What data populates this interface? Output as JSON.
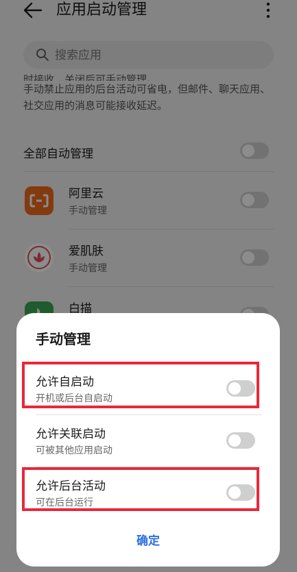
{
  "header": {
    "title": "应用启动管理",
    "back_icon": "arrow-left-icon",
    "more_icon": "more-vertical-icon"
  },
  "search": {
    "placeholder": "搜索应用",
    "icon": "search-icon"
  },
  "description": {
    "line_clipped": "时接收，关闭后可手动管理。",
    "text": "手动禁止应用的后台活动可省电，但邮件、聊天应用、社交应用的消息可能接收延迟。"
  },
  "all_auto": {
    "label": "全部自动管理",
    "enabled": false
  },
  "apps": [
    {
      "name": "阿里云",
      "status": "手动管理",
      "icon": "aliyun-icon",
      "enabled": false
    },
    {
      "name": "爱肌肤",
      "status": "手动管理",
      "icon": "aijifu-icon",
      "enabled": false
    },
    {
      "name": "白描",
      "status": "",
      "icon": "baimiao-icon",
      "enabled": false
    }
  ],
  "dialog": {
    "title": "手动管理",
    "options": [
      {
        "label": "允许自启动",
        "sub": "开机或后台自启动",
        "enabled": false
      },
      {
        "label": "允许关联启动",
        "sub": "可被其他应用启动",
        "enabled": false
      },
      {
        "label": "允许后台活动",
        "sub": "可在后台运行",
        "enabled": false
      }
    ],
    "confirm_label": "确定"
  },
  "colors": {
    "highlight": "#e8283a",
    "accent": "#2a6fe0",
    "aliyun_orange": "#f06a1c"
  }
}
